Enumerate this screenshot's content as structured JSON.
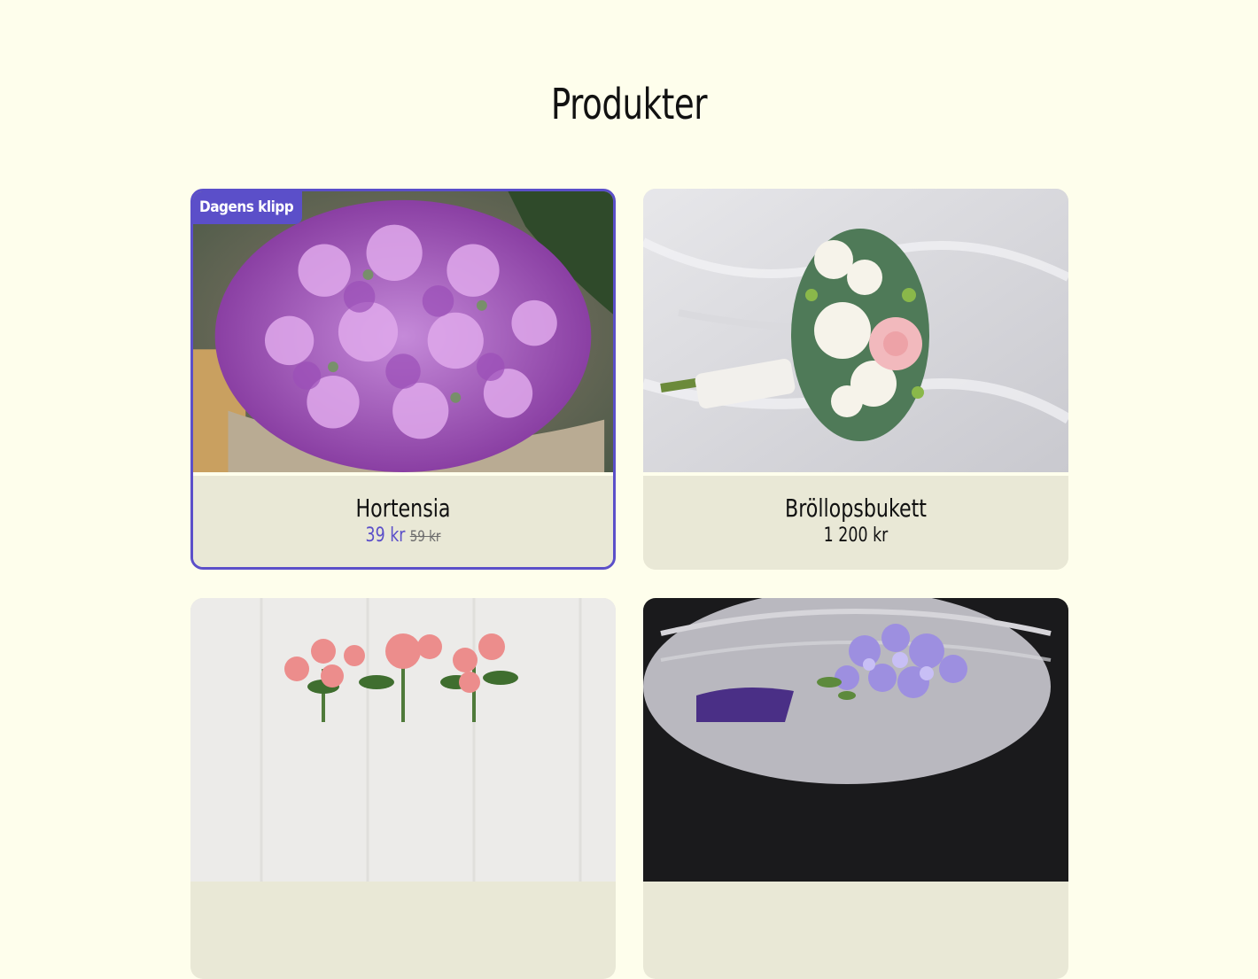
{
  "page": {
    "title": "Produkter"
  },
  "products": [
    {
      "name": "Hortensia",
      "price": "39 kr",
      "old_price": "59 kr",
      "badge": "Dagens klipp",
      "image": "hydrangea-photo"
    },
    {
      "name": "Bröllopsbukett",
      "price": "1 200 kr",
      "image": "wedding-bouquet-photo"
    },
    {
      "image": "pink-roses-photo"
    },
    {
      "image": "purple-flowers-photo"
    }
  ],
  "colors": {
    "background": "#fefeec",
    "card": "#e9e8d6",
    "accent": "#5b4fc9"
  }
}
